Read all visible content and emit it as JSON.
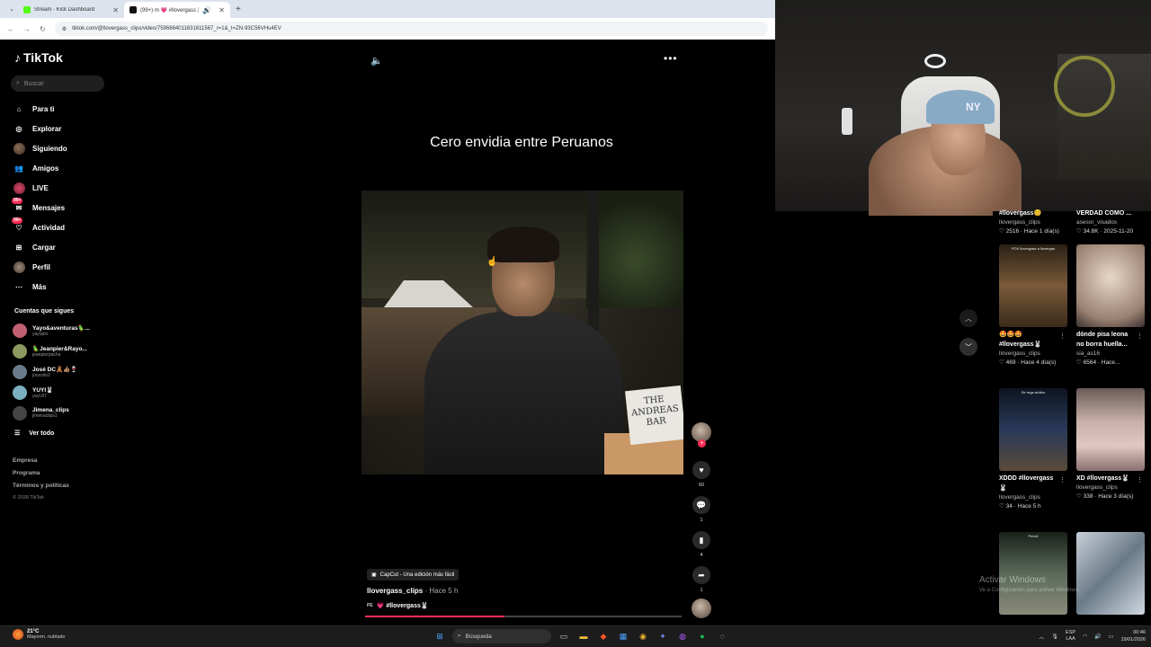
{
  "browser": {
    "tabs": [
      {
        "title": "Stream - Kick Dashboard",
        "favicon_color": "#53fc18"
      },
      {
        "title": "(99+) m 💗 #llovergass🐰",
        "favicon_color": "#111111"
      }
    ],
    "new_tab": "+",
    "url": "tiktok.com/@llovergass_clips/video/7596864011631611567_r=1&_t=ZN-93C56VHu4EV"
  },
  "tiktok": {
    "logo": "TikTok",
    "search_placeholder": "Buscar",
    "nav": [
      {
        "label": "Para ti",
        "icon": "home-icon"
      },
      {
        "label": "Explorar",
        "icon": "compass-icon"
      },
      {
        "label": "Siguiendo",
        "icon": "avatar-icon"
      },
      {
        "label": "Amigos",
        "icon": "friends-icon"
      },
      {
        "label": "LIVE",
        "icon": "live-icon"
      },
      {
        "label": "Mensajes",
        "icon": "messages-icon",
        "badge": "99+"
      },
      {
        "label": "Actividad",
        "icon": "activity-icon",
        "badge": "99+"
      },
      {
        "label": "Cargar",
        "icon": "upload-icon"
      },
      {
        "label": "Perfil",
        "icon": "profile-icon"
      },
      {
        "label": "Más",
        "icon": "more-icon"
      }
    ],
    "following_header": "Cuentas que sigues",
    "following": [
      {
        "name": "Yayo&aventuras🦜...",
        "handle": "yayoplo",
        "color": "#c06070"
      },
      {
        "name": "🦜Jeanpier&Rayo...",
        "handle": "jeanpierpacha",
        "color": "#8a9a60"
      },
      {
        "name": "José DC🧸👍🏽🍷",
        "handle": "jocesito2",
        "color": "#6a7a8a"
      },
      {
        "name": "YUYI🐰",
        "handle": "yuyi.87",
        "color": "#7ab0c0"
      },
      {
        "name": "Jimena_clips",
        "handle": "jimenaclips1",
        "color": "#444444"
      }
    ],
    "see_all": "Ver todo",
    "footer": [
      "Empresa",
      "Programa",
      "Términos y políticas"
    ],
    "copyright": "© 2026 TikTok"
  },
  "video": {
    "caption": "Cero envidia entre Peruanos",
    "sign_text": "THE ANDREAS BAR",
    "likes": "60",
    "comments": "1",
    "saves": "4",
    "shares": "1",
    "capcut": "CapCut - Una edición más fácil",
    "author": "llovergass_clips",
    "time": " · Hace 5 h",
    "flag": "PE",
    "tags": "💗 #llovergass🐰",
    "progress": 0.44
  },
  "webcam": {
    "cap_logo": "NY"
  },
  "grid": [
    {
      "title": "#llovergass😊",
      "author": "llovergass_clips",
      "stats": "♡ 2516 · Hace 1 día(s)",
      "bg": "#4a3a30"
    },
    {
      "title": "VERDAD COMO ...",
      "author": "asesor_visados",
      "stats": "♡ 34.8K · 2025-11-20",
      "bg": "#3a3a4a"
    },
    {
      "label": "POV llovergass a llovergas",
      "title": "🤩🤩🤩",
      "title2": "#llovergass🐰",
      "author": "llovergass_clips",
      "stats": "♡ 469 · Hace 4 día(s)",
      "bg": "#7a5a3a"
    },
    {
      "title": "dónde pisa leona",
      "title2": "no borra huella...",
      "author": "sia_as16",
      "stats": "♡ 6564 · Hace...",
      "bg": "#c8b6a6"
    },
    {
      "label": "Se rega arbitro",
      "title": "XDDD #llovergass",
      "title2": "🐰",
      "author": "llovergass_clips",
      "stats": "♡ 34 · Hace 5 h",
      "bg": "#2a3a5a"
    },
    {
      "title": "XD #llovergass🐰",
      "author": "llovergass_clips",
      "stats": "♡ 338 · Hace 3 día(s)",
      "bg": "#b8a098"
    },
    {
      "label": "Perrof",
      "bg": "#5a6a5a"
    },
    {
      "bg": "#8a9aa8"
    }
  ],
  "windows_watermark": {
    "line1": "Activar Windows",
    "line2": "Ve a Configuración para activar Windows."
  },
  "taskbar": {
    "temp": "21°C",
    "weather": "Mayorm. nublado",
    "search": "Búsqueda",
    "lang": "ESP",
    "lang2": "LAA",
    "time": "00:46",
    "date": "19/01/2026"
  }
}
